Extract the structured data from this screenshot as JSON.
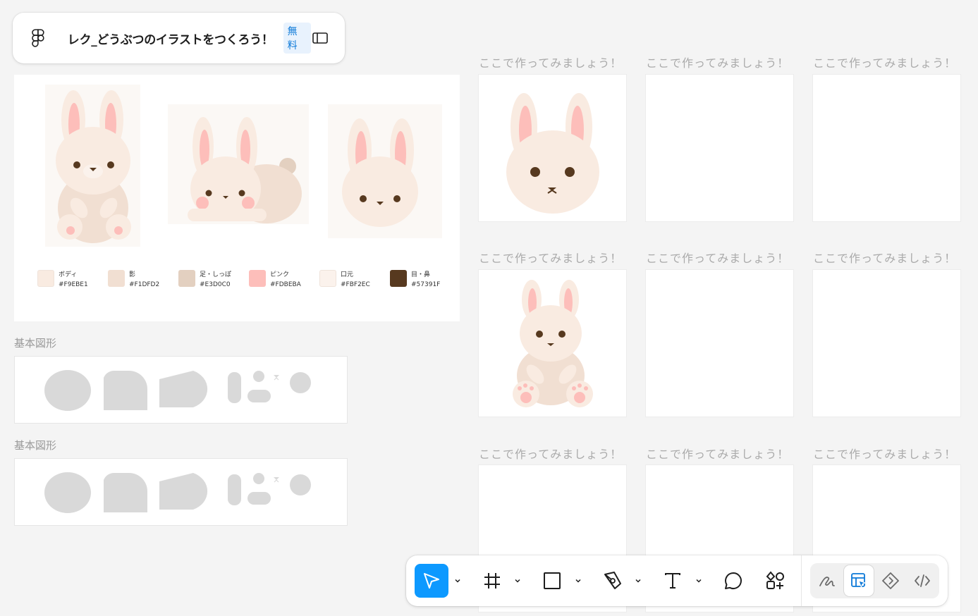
{
  "file": {
    "title": "レク_どうぶつのイラストをつくろう！",
    "badge": "無料"
  },
  "palette": [
    {
      "name": "ボディ",
      "hex": "#F9EBE1"
    },
    {
      "name": "影",
      "hex": "#F1DFD2"
    },
    {
      "name": "足・しっぽ",
      "hex": "#E3D0C0"
    },
    {
      "name": "ピンク",
      "hex": "#FDBEBA"
    },
    {
      "name": "口元",
      "hex": "#FBF2EC"
    },
    {
      "name": "目・鼻",
      "hex": "#57391F"
    }
  ],
  "sections": [
    {
      "label": "基本図形"
    },
    {
      "label": "基本図形"
    }
  ],
  "grid": {
    "cell_label": "ここで作ってみましょう！"
  },
  "toolbar": {
    "tools": [
      "move-tool",
      "frame-tool",
      "rectangle-tool",
      "pen-tool",
      "text-tool",
      "comment-tool",
      "assets-tool"
    ],
    "modes": [
      "draw-mode",
      "design-mode",
      "dev-mode-components",
      "dev-mode-code"
    ],
    "active_tool": "move-tool",
    "active_mode": "design-mode"
  },
  "colors": {
    "accent": "#0d99ff",
    "badge": "#0d79d8",
    "shape_gray": "#d9d9d9"
  }
}
